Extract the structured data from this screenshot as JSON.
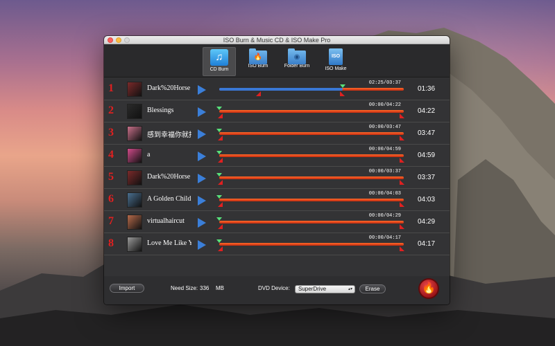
{
  "window": {
    "title": "ISO Burn & Music CD & ISO Make Pro"
  },
  "toolbar": {
    "items": [
      {
        "label": "CD Burn",
        "icon": "music-note-icon"
      },
      {
        "label": "ISO Burn",
        "icon": "folder-flame-icon"
      },
      {
        "label": "Folder Burn",
        "icon": "folder-disc-icon"
      },
      {
        "label": "ISO Make",
        "icon": "iso-document-icon",
        "badge": "ISO"
      }
    ],
    "selected": "CD Burn"
  },
  "tracks": [
    {
      "num": "1",
      "name": "Dark%20Horse",
      "time": "02:25/03:37",
      "duration": "01:36",
      "progress": 0.67,
      "thumb_color": "#7b2a2a",
      "selected": true
    },
    {
      "num": "2",
      "name": "Blessings",
      "time": "00:00/04:22",
      "duration": "04:22",
      "progress": 0,
      "thumb_color": "#2a2a2a"
    },
    {
      "num": "3",
      "name": "感到幸福你就拍",
      "time": "00:00/03:47",
      "duration": "03:47",
      "progress": 0,
      "thumb_color": "#c8708a"
    },
    {
      "num": "4",
      "name": "a",
      "time": "00:00/04:59",
      "duration": "04:59",
      "progress": 0,
      "thumb_color": "#d04b8a"
    },
    {
      "num": "5",
      "name": "Dark%20Horse",
      "time": "00:00/03:37",
      "duration": "03:37",
      "progress": 0,
      "thumb_color": "#7b2a2a"
    },
    {
      "num": "6",
      "name": "A Golden Child",
      "time": "00:00/04:03",
      "duration": "04:03",
      "progress": 0,
      "thumb_color": "#4a6f8f"
    },
    {
      "num": "7",
      "name": "virtualhaircut",
      "time": "00:00/04:29",
      "duration": "04:29",
      "progress": 0,
      "thumb_color": "#b56a4a"
    },
    {
      "num": "8",
      "name": "Love Me Like You",
      "time": "00:00/04:17",
      "duration": "04:17",
      "progress": 0,
      "thumb_color": "#9a9a9a"
    }
  ],
  "footer": {
    "import_label": "Import",
    "need_size_label": "Need Size:",
    "need_size_value": "336",
    "need_size_unit": "MB",
    "dvd_device_label": "DVD Device:",
    "dvd_device_value": "SuperDrive",
    "erase_label": "Erase",
    "burn_icon": "burn-flame-icon"
  },
  "colors": {
    "track_number": "#e02020",
    "progress_played": "#3a78d6",
    "progress_remaining": "#e24a1c",
    "start_marker": "#58e07a",
    "play_button": "#3b7fd9"
  }
}
